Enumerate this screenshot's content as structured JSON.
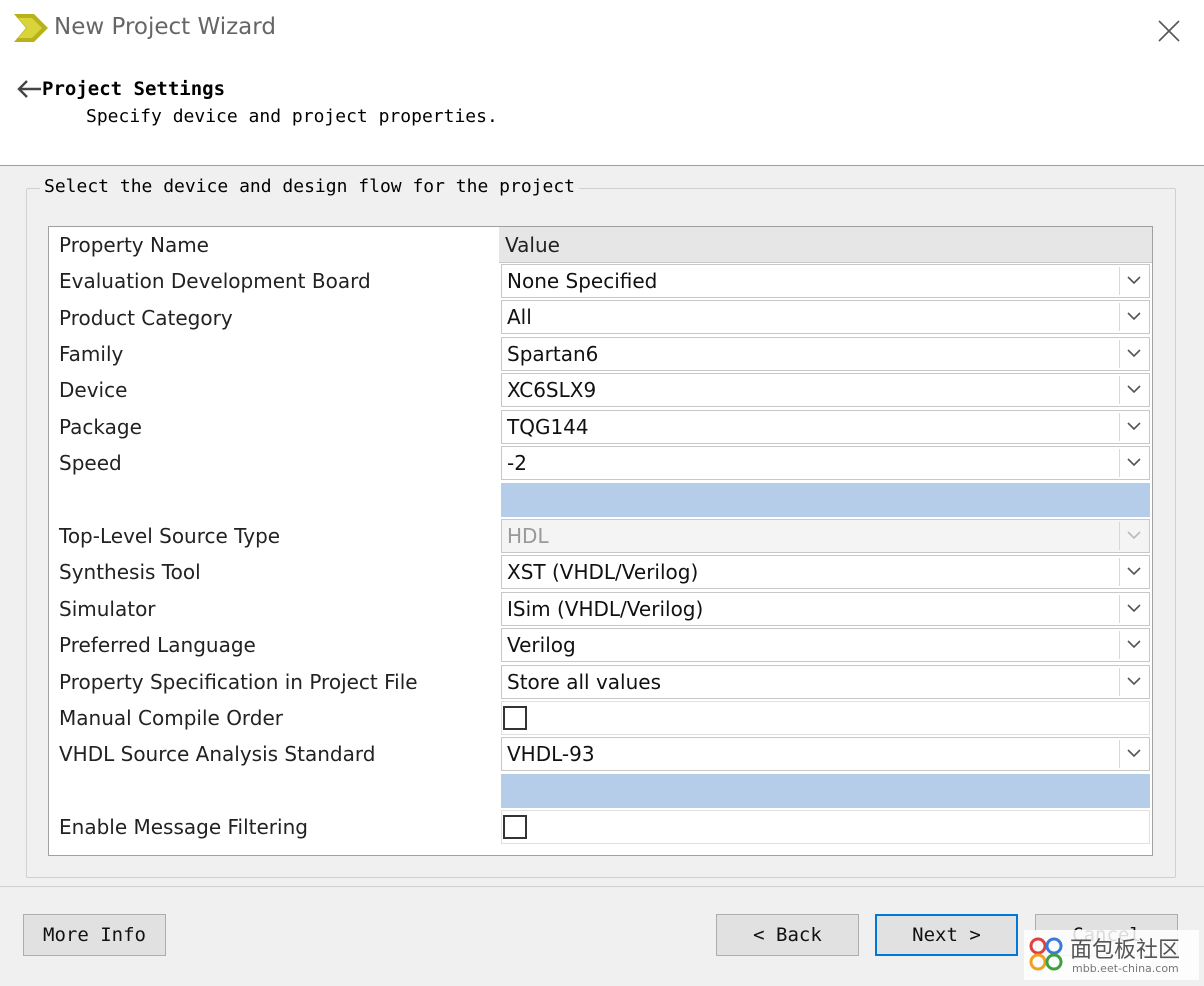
{
  "window": {
    "title": "New Project Wizard"
  },
  "header": {
    "title": "Project Settings",
    "subtitle": "Specify device and project properties."
  },
  "group": {
    "legend": "Select the device and design flow for the project"
  },
  "table": {
    "header_name": "Property Name",
    "header_value": "Value",
    "rows": [
      {
        "label": "Evaluation Development Board",
        "value": "None Specified"
      },
      {
        "label": "Product Category",
        "value": "All"
      },
      {
        "label": "Family",
        "value": "Spartan6"
      },
      {
        "label": "Device",
        "value": "XC6SLX9"
      },
      {
        "label": "Package",
        "value": "TQG144"
      },
      {
        "label": "Speed",
        "value": "-2"
      },
      {
        "label": "Top-Level Source Type",
        "value": "HDL"
      },
      {
        "label": "Synthesis Tool",
        "value": "XST (VHDL/Verilog)"
      },
      {
        "label": "Simulator",
        "value": "ISim (VHDL/Verilog)"
      },
      {
        "label": "Preferred Language",
        "value": "Verilog"
      },
      {
        "label": "Property Specification in Project File",
        "value": "Store all values"
      },
      {
        "label": "Manual Compile Order",
        "value": ""
      },
      {
        "label": "VHDL Source Analysis Standard",
        "value": "VHDL-93"
      },
      {
        "label": "Enable Message Filtering",
        "value": ""
      }
    ]
  },
  "buttons": {
    "more_info": "More Info",
    "back": "< Back",
    "next": "Next >",
    "cancel": "Cancel"
  },
  "watermark": {
    "text": "面包板社区",
    "url": "mbb.eet-china.com"
  },
  "colors": {
    "selection": "#b5cde9",
    "primary_border": "#0078d7",
    "logo": "#c7c21a"
  }
}
